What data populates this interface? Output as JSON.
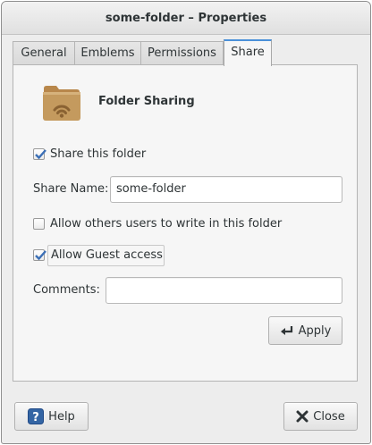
{
  "window": {
    "title": "some-folder – Properties"
  },
  "tabs": [
    {
      "label": "General",
      "active": false
    },
    {
      "label": "Emblems",
      "active": false
    },
    {
      "label": "Permissions",
      "active": false
    },
    {
      "label": "Share",
      "active": true
    }
  ],
  "share": {
    "heading": "Folder Sharing",
    "icon": "folder-sharing-icon",
    "share_this_folder": {
      "label": "Share this folder",
      "checked": true
    },
    "share_name": {
      "label": "Share Name:",
      "value": "some-folder"
    },
    "allow_write": {
      "label": "Allow others users to write in this folder",
      "checked": false
    },
    "allow_guest": {
      "label": "Allow Guest access",
      "checked": true
    },
    "comments": {
      "label": "Comments:",
      "value": ""
    },
    "apply_label": "Apply"
  },
  "footer": {
    "help_label": "Help",
    "close_label": "Close"
  },
  "colors": {
    "accent": "#4a90d9",
    "check": "#3b6fb6",
    "help_icon": "#3465a4",
    "folder": "#c49a5e"
  }
}
